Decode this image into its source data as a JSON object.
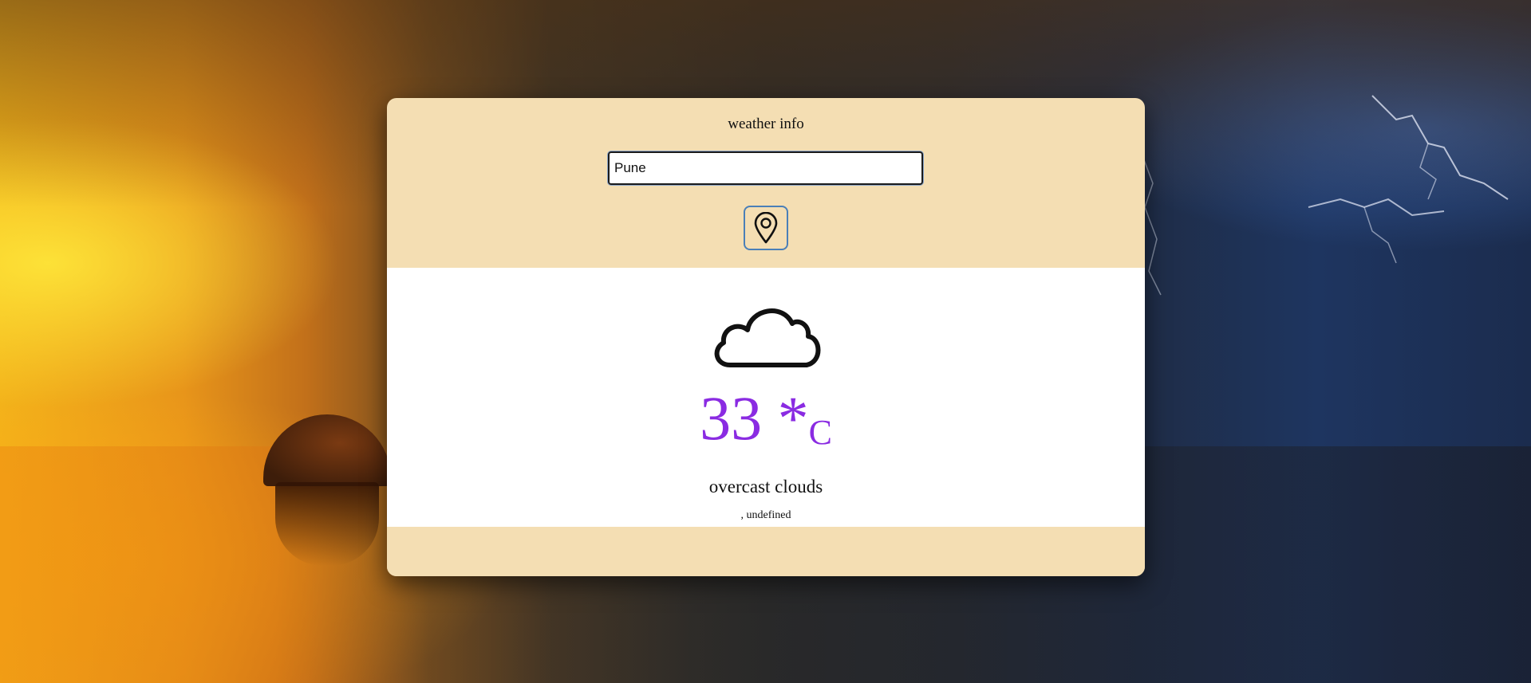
{
  "app": {
    "title": "weather info"
  },
  "search": {
    "value": "Pune",
    "placeholder": ""
  },
  "location_button": {
    "icon": "map-pin-icon"
  },
  "weather": {
    "icon": "cloud-icon",
    "temperature": "33 *",
    "unit": "C",
    "condition": "overcast clouds",
    "location": ", undefined"
  },
  "colors": {
    "card_background": "#f4deb3",
    "body_background": "#ffffff",
    "temperature_color": "#8a2be2",
    "button_border": "#4a7fb8"
  }
}
